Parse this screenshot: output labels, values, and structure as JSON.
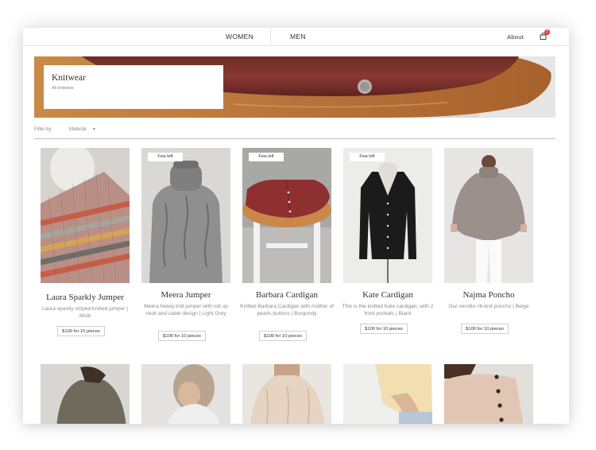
{
  "nav": {
    "women": "WOMEN",
    "men": "MEN",
    "about": "About",
    "cart_count": "1"
  },
  "hero": {
    "title": "Knitwear",
    "subtitle": "All knitwear"
  },
  "filter": {
    "label": "Filter by:",
    "material": "Material"
  },
  "products": [
    {
      "badge": "",
      "name": "Laura Sparkly Jumper",
      "desc": "Laura sparkly striped knitted jumper | Multi",
      "price": "$100 for 10 pieces"
    },
    {
      "badge": "Few left",
      "name": "Meera Jumper",
      "desc": "Meera heavy knit jumper with roll up neck and cable design | Light Grey",
      "price": "$100 for 10 pieces"
    },
    {
      "badge": "Few left",
      "name": "Barbara Cardigan",
      "desc": "Knitted Barbara Cardigan with mother of pearls buttons | Burgundy",
      "price": "$100 for 10 pieces"
    },
    {
      "badge": "Few left",
      "name": "Kate Cardigan",
      "desc": "This is the knitted Kate cardigan, with 2 front pockets | Black",
      "price": "$100 for 10 pieces"
    },
    {
      "badge": "",
      "name": "Najma Poncho",
      "desc": "Our verstile rib-knit poncho | Beige",
      "price": "$100 for 10 pieces"
    }
  ],
  "colors": {
    "accent": "#e03a3a",
    "text": "#333333",
    "muted": "#8a8a8a"
  }
}
